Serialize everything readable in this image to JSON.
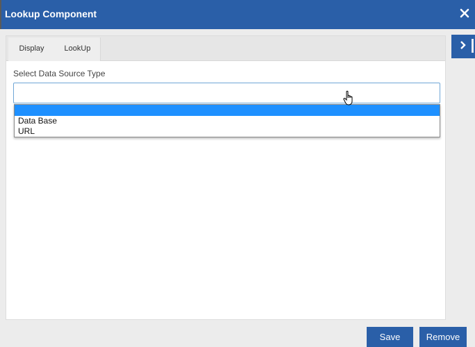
{
  "window": {
    "title": "Lookup Component"
  },
  "tabs": [
    {
      "label": "Display"
    },
    {
      "label": "LookUp"
    }
  ],
  "form": {
    "label": "Select Data Source Type",
    "selected_value": "",
    "options": [
      {
        "label": ""
      },
      {
        "label": "Data Base"
      },
      {
        "label": "URL"
      }
    ]
  },
  "footer": {
    "save_label": "Save",
    "remove_label": "Remove"
  },
  "colors": {
    "accent": "#2a5fa8",
    "highlight": "#1e90ff"
  }
}
